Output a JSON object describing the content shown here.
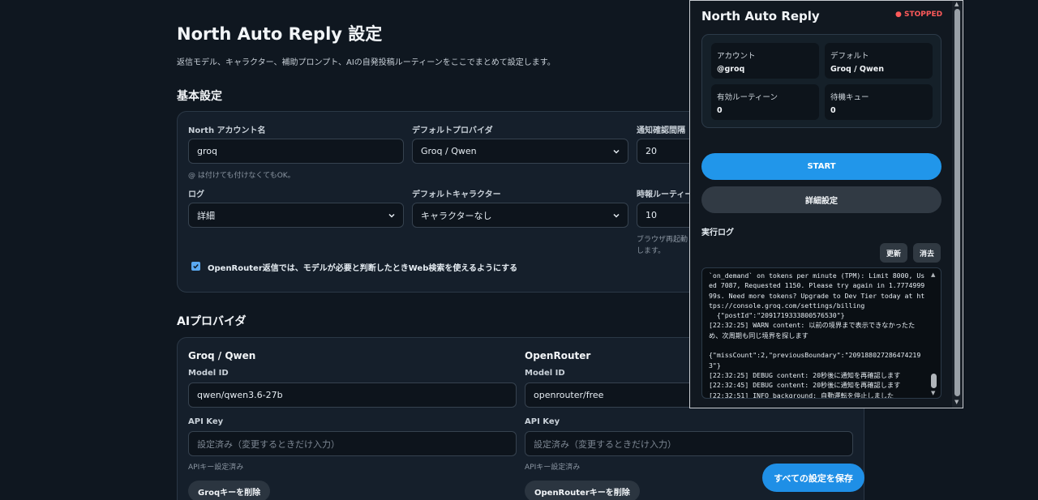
{
  "page": {
    "title": "North Auto Reply 設定",
    "description": "返信モデル、キャラクター、補助プロンプト、AIの自発投稿ルーティーンをここでまとめて設定します。"
  },
  "basic": {
    "section_title": "基本設定",
    "account_label": "North アカウント名",
    "account_value": "groq",
    "account_hint": "@ は付けても付けなくてもOK。",
    "provider_label": "デフォルトプロバイダ",
    "provider_value": "Groq / Qwen",
    "interval_label": "通知確認間隔",
    "interval_value": "20",
    "log_label": "ログ",
    "log_value": "詳細",
    "character_label": "デフォルトキャラクター",
    "character_value": "キャラクターなし",
    "routine_label": "時報ルーティー",
    "routine_value": "10",
    "routine_hint_1": "ブラウザ再起動",
    "routine_hint_2": "します。",
    "web_search_label": "OpenRouter返信では、モデルが必要と判断したときWeb検索を使えるようにする"
  },
  "ai": {
    "section_title": "AIプロバイダ",
    "groq": {
      "title": "Groq / Qwen",
      "model_label": "Model ID",
      "model_value": "qwen/qwen3.6-27b",
      "key_label": "API Key",
      "key_placeholder": "設定済み（変更するときだけ入力）",
      "key_hint": "APIキー設定済み",
      "delete_label": "Groqキーを削除"
    },
    "openrouter": {
      "title": "OpenRouter",
      "model_label": "Model ID",
      "model_value": "openrouter/free",
      "key_label": "API Key",
      "key_placeholder": "設定済み（変更するときだけ入力）",
      "key_hint": "APIキー設定済み",
      "delete_label": "OpenRouterキーを削除"
    }
  },
  "save_label": "すべての設定を保存",
  "popup": {
    "title": "North Auto Reply",
    "status": "● STOPPED",
    "stats": [
      {
        "label": "アカウント",
        "value": "@groq"
      },
      {
        "label": "デフォルト",
        "value": "Groq / Qwen"
      },
      {
        "label": "有効ルーティーン",
        "value": "0"
      },
      {
        "label": "待機キュー",
        "value": "0"
      }
    ],
    "start_label": "START",
    "detail_label": "詳細設定",
    "log_title": "実行ログ",
    "refresh_label": "更新",
    "clear_label": "消去",
    "log_lines": [
      "`on_demand` on tokens per minute (TPM): Limit 8000, Used 7087, Requested 1150. Please try again in 1.777499999s. Need more tokens? Upgrade to Dev Tier today at https://console.groq.com/settings/billing",
      "  {\"postId\":\"2091719333800576530\"}",
      "[22:32:25] WARN content: 以前の境界まで表示できなかったため、次周期も同じ境界を探します",
      "",
      "{\"missCount\":2,\"previousBoundary\":\"2091880272864742193\"}",
      "[22:32:25] DEBUG content: 20秒後に通知を再確認します",
      "[22:32:45] DEBUG content: 20秒後に通知を再確認します",
      "[22:32:51] INFO background: 自動運転を停止しました"
    ]
  }
}
